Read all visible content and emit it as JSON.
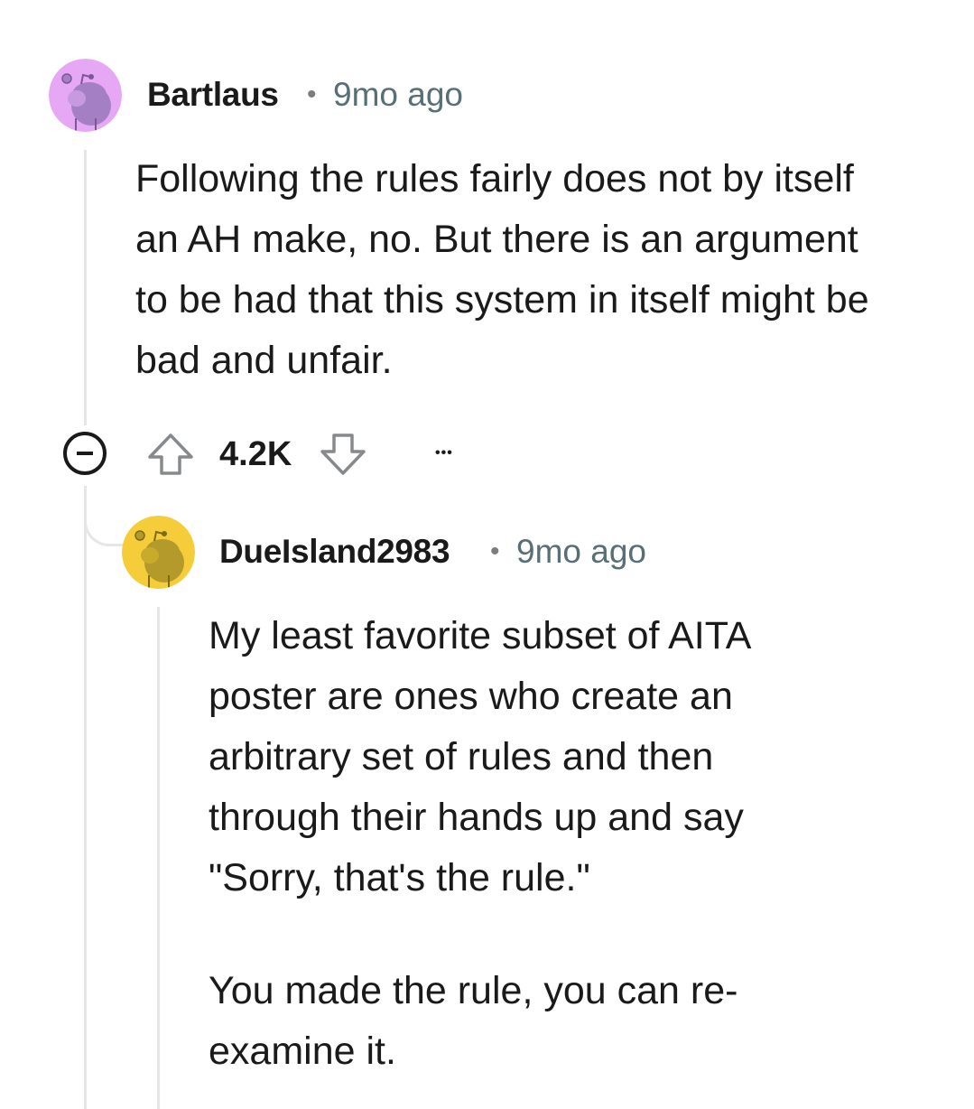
{
  "comments": [
    {
      "username": "Bartlaus",
      "separator": "•",
      "timestamp": "9mo ago",
      "avatar_color": "#e6a7f5",
      "body": [
        "Following the rules fairly does not by itself an AH make, no. But there is an argument to be had that this system in itself might be bad and unfair."
      ],
      "votes": "4.2K",
      "more": "•••",
      "icons": [
        "avatar",
        "collapse-icon",
        "upvote-icon",
        "downvote-icon",
        "more-options-icon"
      ]
    },
    {
      "username": "DueIsland2983",
      "separator": "•",
      "timestamp": "9mo ago",
      "avatar_color": "#f5cd3a",
      "body": [
        "My least favorite subset of AITA poster are ones who create an arbitrary set of rules and then through their hands up and say \"Sorry, that's the rule.\"",
        "You made the rule, you can re-examine it."
      ]
    }
  ]
}
